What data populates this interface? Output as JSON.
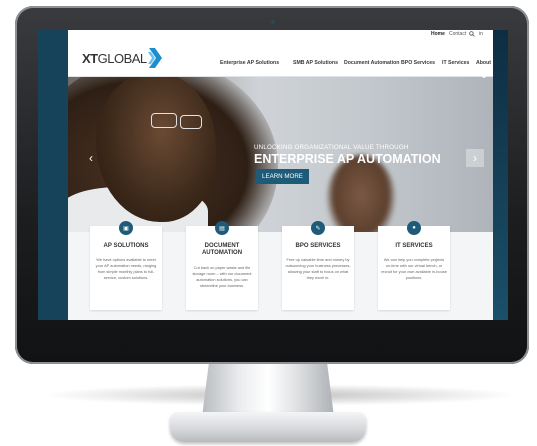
{
  "topbar": {
    "home": "Home",
    "contact": "Contact",
    "search_icon": "search-icon",
    "linkedin": "in"
  },
  "brand": {
    "logo_xt": "XT",
    "logo_global": "GLOBAL",
    "chevron_color": "#1d8fd0"
  },
  "nav": {
    "items": [
      "Enterprise AP Solutions",
      "SMB AP Solutions",
      "Document Automation",
      "BPO Services",
      "IT Services",
      "About"
    ]
  },
  "hero": {
    "subtitle": "UNLOCKING ORGANIZATIONAL VALUE THROUGH",
    "title": "ENTERPRISE AP AUTOMATION",
    "button": "LEARN MORE",
    "prev": "‹",
    "next": "›"
  },
  "services": [
    {
      "icon": "briefcase-icon",
      "glyph": "▣",
      "title": "AP SOLUTIONS",
      "text": "We have options available to meet your AP automation needs, ranging from simple monthly plans to full-service, custom solutions."
    },
    {
      "icon": "document-icon",
      "glyph": "▤",
      "title": "DOCUMENT AUTOMATION",
      "text": "Cut back on paper waste and file storage room – with our document automation solutions, you can streamline your business."
    },
    {
      "icon": "wrench-icon",
      "glyph": "✎",
      "title": "BPO SERVICES",
      "text": "Free up valuable time and money by outsourcing your business processes, allowing your staff to focus on what they excel in."
    },
    {
      "icon": "mouse-icon",
      "glyph": "●",
      "title": "IT SERVICES",
      "text": "We can help you complete projects on-time with our virtual bench, or recruit for your own available in-house positions."
    }
  ],
  "colors": {
    "accent": "#1d5b79",
    "monitor_bezel": "#1c1d1f",
    "screen_side": "#16425a"
  }
}
